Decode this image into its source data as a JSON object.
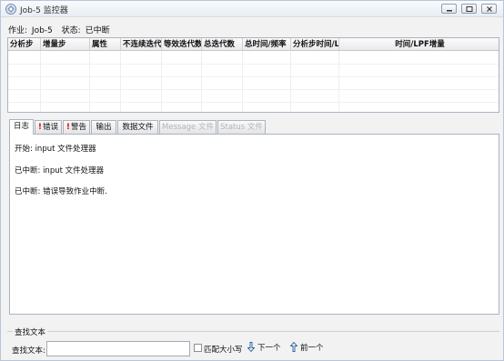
{
  "window": {
    "title": "Job-5 监控器"
  },
  "job_info": {
    "job_label": "作业:",
    "job_value": "Job-5",
    "status_label": "状态:",
    "status_value": "已中断"
  },
  "grid": {
    "columns": [
      "分析步",
      "增量步",
      "属性",
      "不连续迭代",
      "等效迭代数",
      "总迭代数",
      "总时间/频率",
      "分析步时间/LPF",
      "时间/LPF增量"
    ],
    "rows": []
  },
  "tabs": [
    {
      "label": "日志",
      "state": "active",
      "warn": false
    },
    {
      "label": "错误",
      "state": "normal",
      "warn": true
    },
    {
      "label": "警告",
      "state": "normal",
      "warn": true
    },
    {
      "label": "输出",
      "state": "normal",
      "warn": false
    },
    {
      "label": "数据文件",
      "state": "normal",
      "warn": false
    },
    {
      "label": "Message 文件",
      "state": "disabled",
      "warn": false
    },
    {
      "label": "Status 文件",
      "state": "disabled",
      "warn": false
    }
  ],
  "log": {
    "lines": [
      "开始:  input 文件处理器",
      "已中断:  input 文件处理器",
      "已中断:  错误导致作业中断."
    ]
  },
  "find": {
    "group_title": "查找文本",
    "label": "查找文本:",
    "input_value": "",
    "match_case_label": "匹配大小写",
    "match_case_checked": false,
    "next_label": "下一个",
    "prev_label": "前一个"
  },
  "colors": {
    "warn": "#d40000",
    "border": "#a9b4c2",
    "nav_arrow": "#2f5f9a"
  }
}
